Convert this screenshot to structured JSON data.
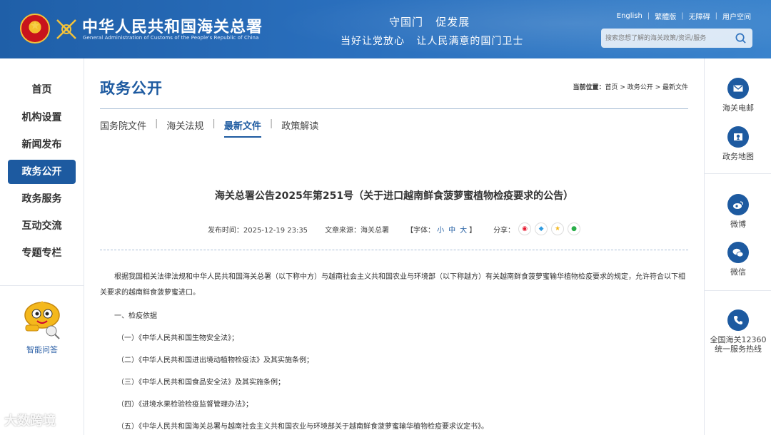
{
  "header": {
    "site_title": "中华人民共和国海关总署",
    "site_subtitle": "General Administration of Customs of the People's Republic of China",
    "slogan_line1": "守国门   促发展",
    "slogan_line2": "当好让党放心   让人民满意的国门卫士",
    "top_links": [
      "English",
      "繁體版",
      "无障碍",
      "用户空间"
    ],
    "search_placeholder": "搜索您想了解的海关政策/资讯/服务"
  },
  "left_nav": {
    "items": [
      {
        "label": "首页",
        "active": false
      },
      {
        "label": "机构设置",
        "active": false
      },
      {
        "label": "新闻发布",
        "active": false
      },
      {
        "label": "政务公开",
        "active": true
      },
      {
        "label": "政务服务",
        "active": false
      },
      {
        "label": "互动交流",
        "active": false
      },
      {
        "label": "专题专栏",
        "active": false
      }
    ],
    "assistant_label": "智能问答"
  },
  "right_bar": {
    "items": [
      {
        "label": "海关电邮",
        "icon": "mail-icon"
      },
      {
        "label": "政务地图",
        "icon": "map-icon"
      },
      {
        "label": "微博",
        "icon": "weibo-icon"
      },
      {
        "label": "微信",
        "icon": "wechat-icon"
      },
      {
        "label_line1": "全国海关12360",
        "label_line2": "统一服务热线",
        "icon": "phone-icon"
      }
    ]
  },
  "main": {
    "section_title": "政务公开",
    "breadcrumb": {
      "label": "当前位置：",
      "path": "首页 > 政务公开 > 最新文件"
    },
    "tabs": [
      {
        "label": "国务院文件",
        "active": false
      },
      {
        "label": "海关法规",
        "active": false
      },
      {
        "label": "最新文件",
        "active": true
      },
      {
        "label": "政策解读",
        "active": false
      }
    ],
    "article": {
      "title": "海关总署公告2025年第251号（关于进口越南鲜食菠萝蜜植物检疫要求的公告）",
      "publish_time": "发布时间：2025-12-19 23:35",
      "source": "文章来源：海关总署",
      "font_size": {
        "label": "【字体：",
        "options": [
          "小",
          "中",
          "大"
        ],
        "close": "】"
      },
      "share_label": "分享：",
      "intro": "根据我国相关法律法规和中华人民共和国海关总署（以下称中方）与越南社会主义共和国农业与环境部（以下称越方）有关越南鲜食菠萝蜜输华植物检疫要求的规定，允许符合以下相关要求的越南鲜食菠萝蜜进口。",
      "section1": "一、检疫依据",
      "items": [
        "（一）《中华人民共和国生物安全法》；",
        "（二）《中华人民共和国进出境动植物检疫法》及其实施条例；",
        "（三）《中华人民共和国食品安全法》及其实施条例；",
        "（四）《进境水果检验检疫监督管理办法》；",
        "（五）《中华人民共和国海关总署与越南社会主义共和国农业与环境部关于越南鲜食菠萝蜜输华植物检疫要求议定书》。"
      ]
    }
  },
  "watermark": "大数跨境",
  "colors": {
    "brand_blue": "#1d5aa0",
    "header_blue": "#2a6fbd"
  }
}
